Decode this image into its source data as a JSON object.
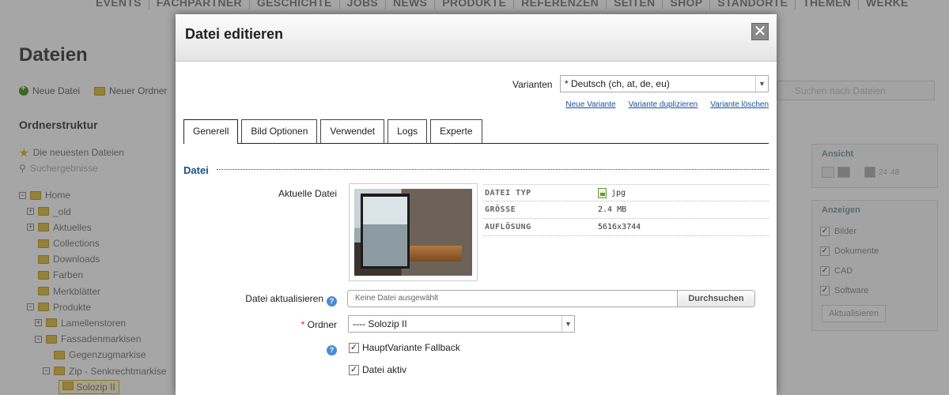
{
  "background": {
    "topnav": [
      "EVENTS",
      "FACHPARTNER",
      "GESCHICHTE",
      "JOBS",
      "NEWS",
      "PRODUKTE",
      "REFERENZEN",
      "SEITEN",
      "SHOP",
      "STANDORTE",
      "THEMEN",
      "WERKE"
    ],
    "page_title": "Dateien",
    "toolbar": {
      "new_file": "Neue Datei",
      "new_folder": "Neuer Ordner"
    },
    "tree_title": "Ordnerstruktur",
    "tree": {
      "newest": "Die neuesten Dateien",
      "search_results": "Suchergebnisse",
      "home": "Home",
      "old": "_old",
      "aktuelles": "Aktuelles",
      "collections": "Collections",
      "downloads": "Downloads",
      "farben": "Farben",
      "merkblaetter": "Merkblätter",
      "produkte": "Produkte",
      "lamellenstoren": "Lamellenstoren",
      "fassadenmarkisen": "Fassadenmarkisen",
      "gegenzugmarkise": "Gegenzugmarkise",
      "zip": "Zip - Senkrechtmarkise",
      "solozip": "Solozip II"
    },
    "search_placeholder": "Suchen nach Dateien",
    "ansicht": {
      "legend": "Ansicht",
      "n24": "24",
      "n48": "48"
    },
    "anzeigen": {
      "legend": "Anzeigen",
      "items": [
        "Bilder",
        "Dokumente",
        "CAD",
        "Software"
      ],
      "button": "Aktualisieren"
    }
  },
  "modal": {
    "title": "Datei editieren",
    "close_glyph": "✕",
    "variants_label": "Varianten",
    "variants_value": "* Deutsch (ch, at, de, eu)",
    "links": {
      "new": "Neue Variante",
      "duplicate": "Variante duplizieren",
      "delete": "Variante löschen"
    },
    "tabs": [
      "Generell",
      "Bild Optionen",
      "Verwendet",
      "Logs",
      "Experte"
    ],
    "section_title": "Datei",
    "current_file_label": "Aktuelle Datei",
    "file_info": {
      "type_label": "DATEI TYP",
      "type_value": "jpg",
      "size_label": "GRÖSSE",
      "size_value": "2.4 MB",
      "resolution_label": "AUFLÖSUNG",
      "resolution_value": "5616x3744"
    },
    "update_label": "Datei aktualisieren",
    "no_file": "Keine Datei ausgewählt",
    "browse": "Durchsuchen",
    "folder_label": "Ordner",
    "required_mark": "*",
    "folder_value": "---- Solozip II",
    "fallback_label": "HauptVariante Fallback",
    "active_label": "Datei aktiv"
  }
}
